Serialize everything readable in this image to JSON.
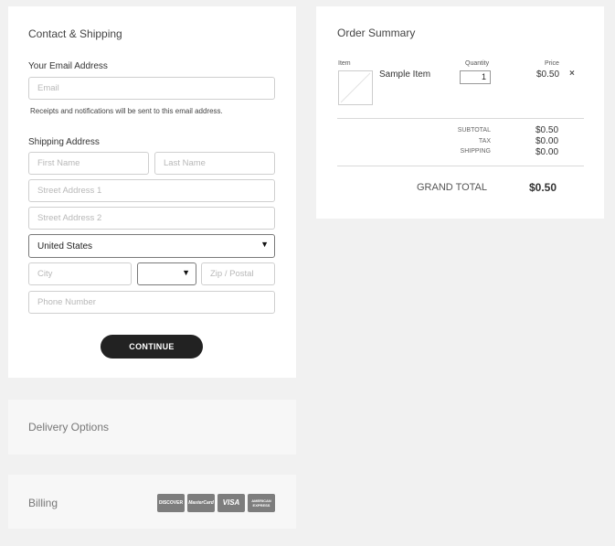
{
  "contact": {
    "title": "Contact & Shipping",
    "email_label": "Your Email Address",
    "email_placeholder": "Email",
    "email_note": "Receipts and notifications will be sent to this email address.",
    "shipping_label": "Shipping Address",
    "first_name_placeholder": "First Name",
    "last_name_placeholder": "Last Name",
    "street1_placeholder": "Street Address 1",
    "street2_placeholder": "Street Address 2",
    "country_value": "United States",
    "city_placeholder": "City",
    "state_value": "",
    "zip_placeholder": "Zip / Postal",
    "phone_placeholder": "Phone Number",
    "continue_label": "CONTINUE"
  },
  "delivery": {
    "title": "Delivery Options"
  },
  "billing": {
    "title": "Billing",
    "cards": [
      "DISCOVER",
      "MasterCard",
      "VISA",
      "AMERICAN EXPRESS"
    ]
  },
  "order": {
    "title": "Order Summary",
    "col_item": "Item",
    "col_quantity": "Quantity",
    "col_price": "Price",
    "item_name": "Sample Item",
    "item_quantity": "1",
    "item_price": "$0.50",
    "remove_symbol": "×",
    "subtotal_label": "SUBTOTAL",
    "subtotal_value": "$0.50",
    "tax_label": "TAX",
    "tax_value": "$0.00",
    "shipping_label": "SHIPPING",
    "shipping_value": "$0.00",
    "grand_total_label": "GRAND TOTAL",
    "grand_total_value": "$0.50"
  },
  "icons": {
    "caret": "▼",
    "remove": "×"
  }
}
